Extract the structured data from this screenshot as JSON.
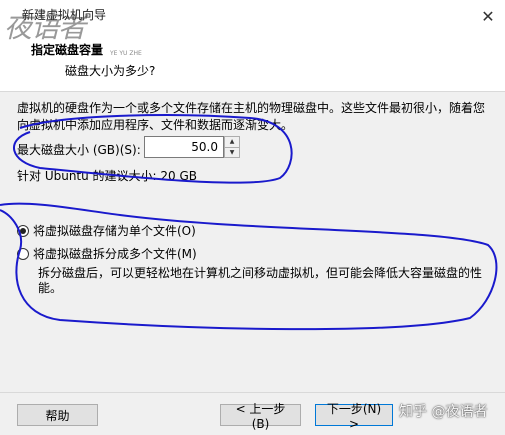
{
  "window": {
    "title": "新建虚拟机向导",
    "close_icon": "close-icon"
  },
  "watermark": {
    "logo_text": "夜语者",
    "small_text": "YE YU ZHE",
    "zhihu_text": "知乎 @夜语者"
  },
  "header": {
    "title": "指定磁盘容量",
    "subtitle": "磁盘大小为多少?"
  },
  "intro": {
    "text": "虚拟机的硬盘作为一个或多个文件存储在主机的物理磁盘中。这些文件最初很小，随着您向虚拟机中添加应用程序、文件和数据而逐渐变大。"
  },
  "disk_size": {
    "label": "最大磁盘大小 (GB)(S):",
    "value": "50.0",
    "spinner_up_icon": "spin-up-icon",
    "spinner_down_icon": "spin-down-icon"
  },
  "recommendation": {
    "text": "针对 Ubuntu 的建议大小: 20 GB"
  },
  "storage_options": [
    {
      "label": "将虚拟磁盘存储为单个文件(O)",
      "selected": true
    },
    {
      "label": "将虚拟磁盘拆分成多个文件(M)",
      "selected": false
    }
  ],
  "split_description": "拆分磁盘后，可以更轻松地在计算机之间移动虚拟机，但可能会降低大容量磁盘的性能。",
  "buttons": {
    "help": "帮助",
    "back": "< 上一步(B)",
    "next": "下一步(N) >"
  },
  "colors": {
    "annotation_ink": "#1a1acc",
    "focus_border": "#0078d7"
  }
}
